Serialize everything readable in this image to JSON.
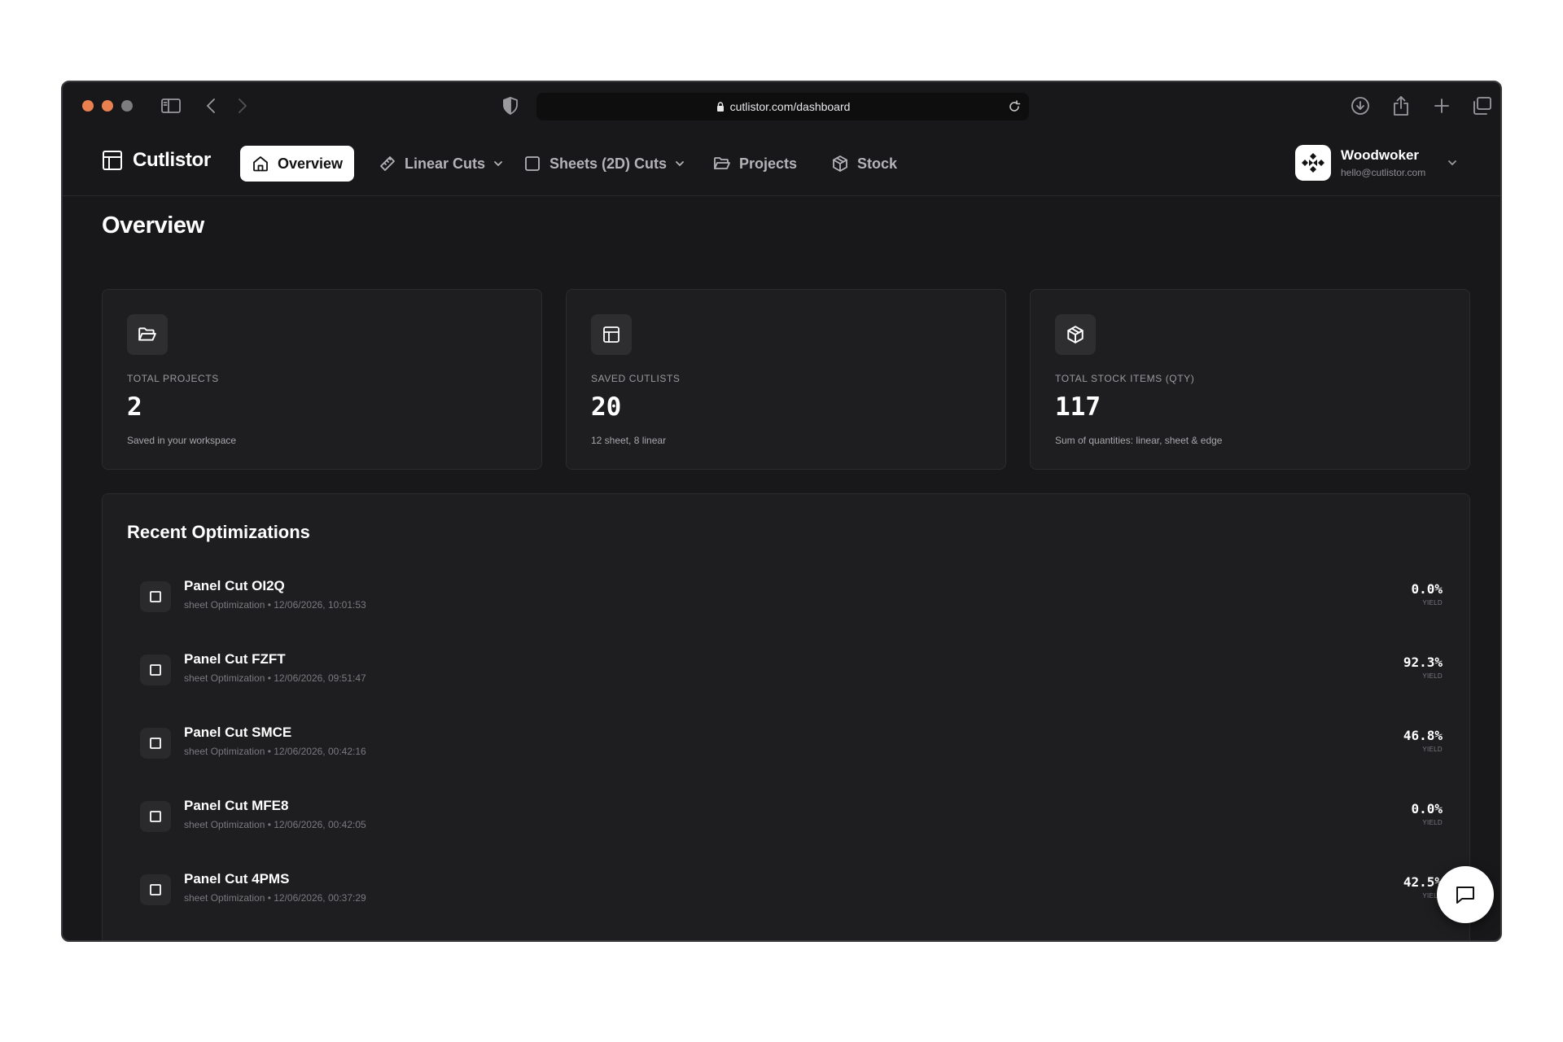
{
  "browser": {
    "url": "cutlistor.com/dashboard"
  },
  "app": {
    "brand": "Cutlistor",
    "nav": {
      "overview": "Overview",
      "linear_cuts": "Linear Cuts",
      "sheets_cuts": "Sheets (2D) Cuts",
      "projects": "Projects",
      "stock": "Stock"
    },
    "user": {
      "name": "Woodwoker",
      "email": "hello@cutlistor.com"
    }
  },
  "page": {
    "title": "Overview"
  },
  "stats": [
    {
      "label": "TOTAL PROJECTS",
      "value": "2",
      "sub": "Saved in your workspace",
      "icon": "folder-open-icon"
    },
    {
      "label": "SAVED CUTLISTS",
      "value": "20",
      "sub": "12 sheet, 8 linear",
      "icon": "layout-icon"
    },
    {
      "label": "TOTAL STOCK ITEMS (QTY)",
      "value": "117",
      "sub": "Sum of quantities: linear, sheet & edge",
      "icon": "package-icon"
    }
  ],
  "recent": {
    "title": "Recent Optimizations",
    "yield_label": "YIELD",
    "items": [
      {
        "name": "Panel Cut OI2Q",
        "meta": "sheet Optimization • 12/06/2026, 10:01:53",
        "yield": "0.0%"
      },
      {
        "name": "Panel Cut FZFT",
        "meta": "sheet Optimization • 12/06/2026, 09:51:47",
        "yield": "92.3%"
      },
      {
        "name": "Panel Cut SMCE",
        "meta": "sheet Optimization • 12/06/2026, 00:42:16",
        "yield": "46.8%"
      },
      {
        "name": "Panel Cut MFE8",
        "meta": "sheet Optimization • 12/06/2026, 00:42:05",
        "yield": "0.0%"
      },
      {
        "name": "Panel Cut 4PMS",
        "meta": "sheet Optimization • 12/06/2026, 00:37:29",
        "yield": "42.5%"
      }
    ]
  },
  "colors": {
    "background": "#18181a",
    "card": "#1e1e20",
    "accent_active": "#ffffff",
    "traffic_close": "#e8804f",
    "traffic_min": "#e8804f",
    "traffic_max": "#7d7d80"
  }
}
